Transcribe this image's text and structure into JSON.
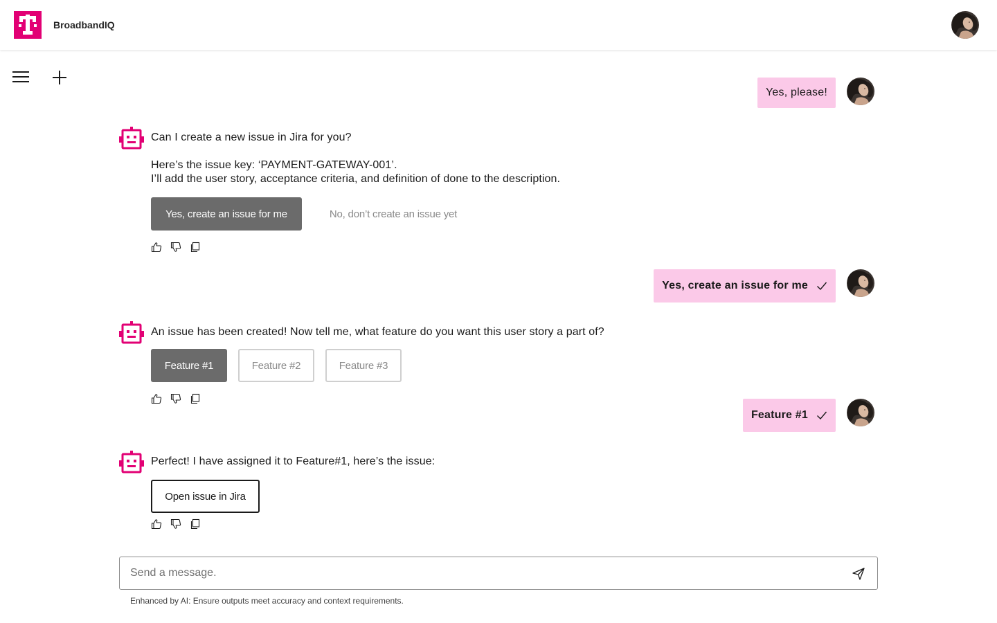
{
  "header": {
    "app_name": "BroadbandIQ",
    "brand_color": "#e20074"
  },
  "icons": {
    "logo": "telekom-t-logo",
    "menu": "hamburger-icon",
    "new_chat": "plus-icon",
    "bot": "robot-icon",
    "like": "thumbs-up-icon",
    "dislike": "thumbs-down-icon",
    "copy": "copy-icon",
    "send": "send-icon",
    "check": "check-icon"
  },
  "conversation": {
    "user_1": "Yes, please!",
    "bot_1": {
      "question": "Can I create a new issue in Jira for you?",
      "line_1": "Here’s the issue key: ‘PAYMENT-GATEWAY-001’.",
      "line_2": "I’ll add the user story, acceptance criteria, and definition of done to the description.",
      "primary_button": "Yes, create an issue for me",
      "secondary_button": "No, don’t create an issue yet"
    },
    "user_2": "Yes, create an issue for me",
    "bot_2": {
      "text": "An issue has been created! Now tell me, what feature do you want this user story a part of?",
      "options": [
        "Feature #1",
        "Feature #2",
        "Feature #3"
      ]
    },
    "user_3": "Feature #1",
    "bot_3": {
      "text": "Perfect! I have assigned it to Feature#1, here’s the issue:",
      "link_button": "Open issue in Jira"
    }
  },
  "composer": {
    "placeholder": "Send a message.",
    "value": ""
  },
  "disclaimer": "Enhanced by AI: Ensure outputs meet accuracy and context requirements.",
  "colors": {
    "user_bubble": "#fbc9e8",
    "selected_button": "#6b6b6b"
  }
}
